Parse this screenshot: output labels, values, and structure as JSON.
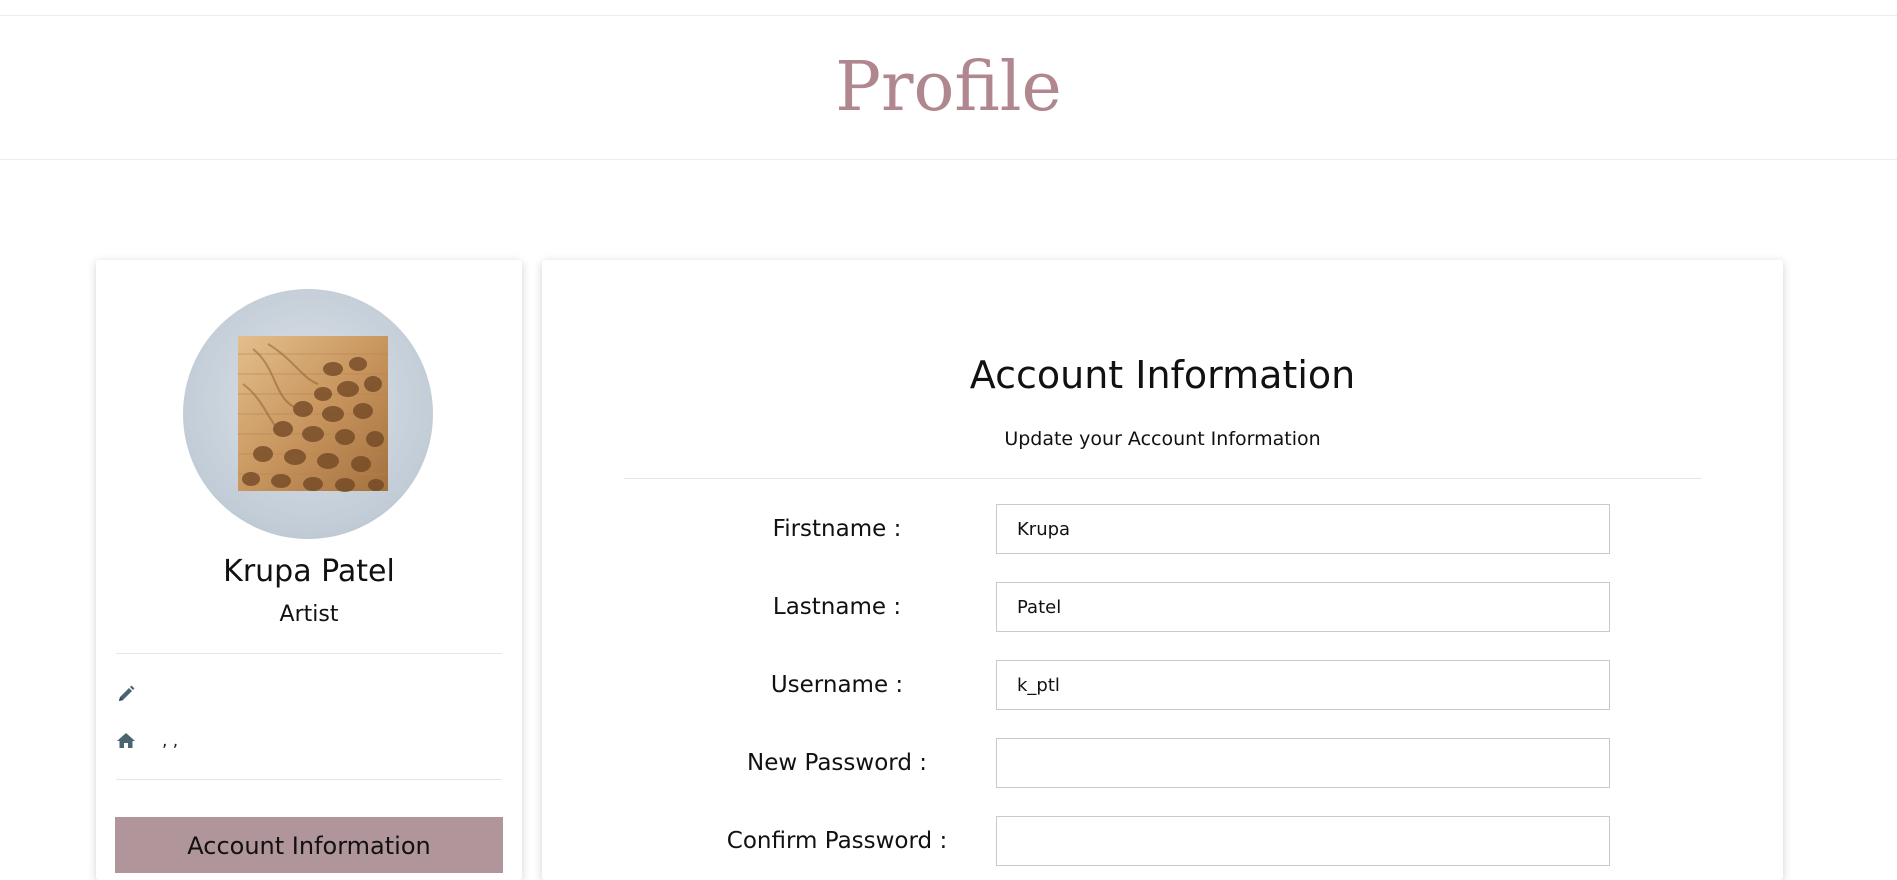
{
  "header": {
    "title": "Profile"
  },
  "profile": {
    "name": "Krupa Patel",
    "role": "Artist",
    "bio": "",
    "address": ", ,",
    "menu": {
      "account_label": "Account Information"
    }
  },
  "account": {
    "title": "Account Information",
    "subtitle": "Update your Account Information",
    "fields": [
      {
        "label": "Firstname :",
        "value": "Krupa"
      },
      {
        "label": "Lastname :",
        "value": "Patel"
      },
      {
        "label": "Username :",
        "value": "k_ptl"
      },
      {
        "label": "New Password :",
        "value": ""
      },
      {
        "label": "Confirm Password :",
        "value": ""
      }
    ]
  },
  "colors": {
    "title": "#b0878e",
    "menu_active": "#b0959a",
    "icon": "#4a6572"
  },
  "icons": {
    "bio": "pencil-icon",
    "address": "home-icon"
  }
}
